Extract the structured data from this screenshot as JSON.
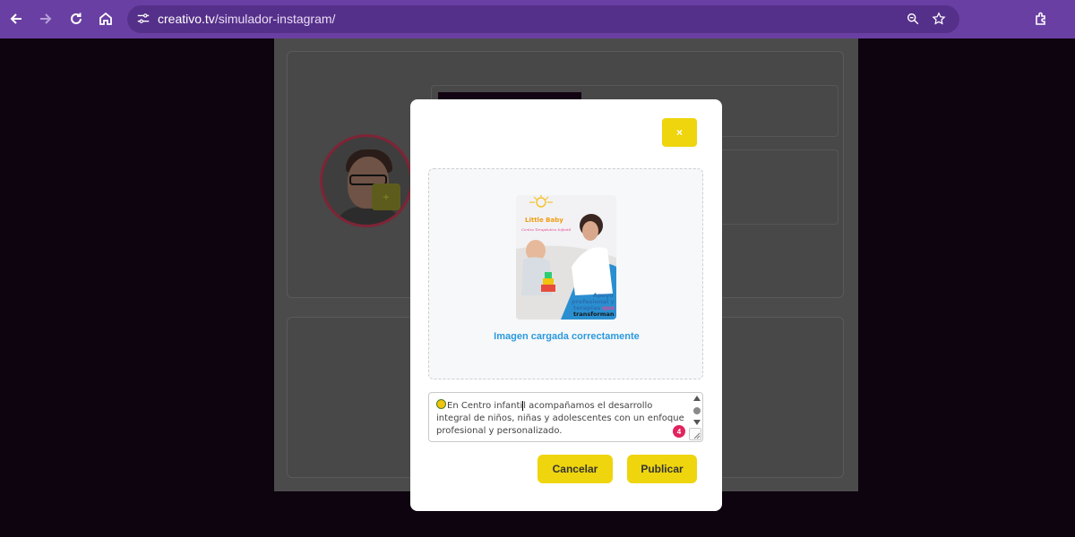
{
  "browser": {
    "url_host": "creativo.tv",
    "url_path": "/simulador-instagram/",
    "icons": [
      "back-arrow-icon",
      "forward-arrow-icon",
      "reload-icon",
      "home-icon",
      "site-settings-icon",
      "zoom-icon",
      "bookmark-star-icon",
      "extensions-icon"
    ]
  },
  "modal": {
    "close_label": "×",
    "upload_status": "Imagen cargada correctamente",
    "preview_image": {
      "logo_line1": "Little Baby",
      "logo_line2": "Centro Terapéutico Infantil",
      "headline_line1": "Apoyo",
      "headline_line2": "profesional y",
      "headline_line3_a": "terapias",
      "headline_line3_b": "que",
      "headline_line4": "transforman"
    },
    "caption": {
      "text_before_cursor": "En Centro infanti",
      "text_after_cursor": "l acompañamos el desarrollo integral de niños, niñas y adolescentes con un enfoque profesional y personalizado.",
      "counter": "4"
    },
    "buttons": {
      "cancel_label": "Cancelar",
      "publish_label": "Publicar"
    }
  },
  "colors": {
    "toolbar": "#6a3fa3",
    "accent_yellow": "#eed50d",
    "link_blue": "#2b9adf",
    "counter_red": "#e0245e"
  }
}
